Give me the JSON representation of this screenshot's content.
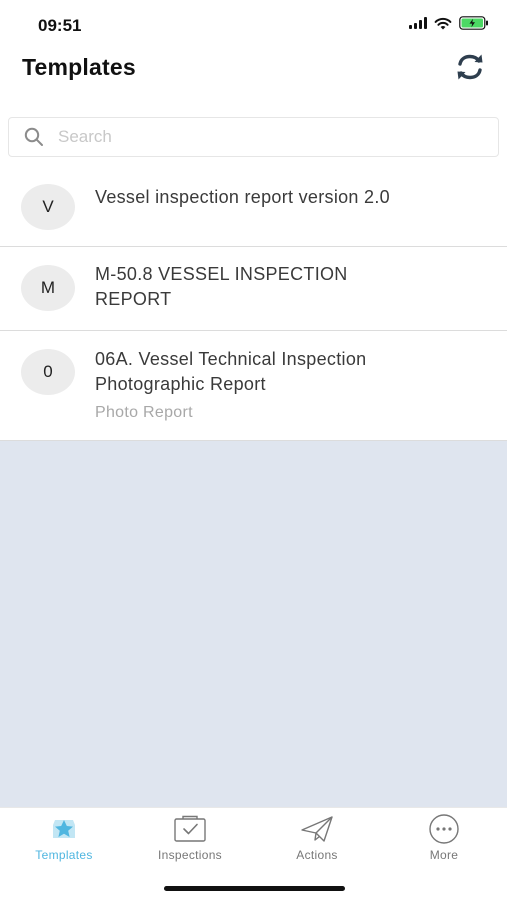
{
  "status_bar": {
    "time": "09:51"
  },
  "header": {
    "title": "Templates"
  },
  "search": {
    "placeholder": "Search"
  },
  "templates": [
    {
      "avatar": "V",
      "title": "Vessel inspection report version 2.0"
    },
    {
      "avatar": "M",
      "title": "M-50.8 VESSEL INSPECTION REPORT"
    },
    {
      "avatar": "0",
      "title": "06A. Vessel Technical Inspection Photographic Report",
      "subtitle": "Photo Report"
    }
  ],
  "tabbar": {
    "tabs": [
      {
        "label": "Templates",
        "icon": "star-badge-icon",
        "active": true
      },
      {
        "label": "Inspections",
        "icon": "clipboard-check-icon",
        "active": false
      },
      {
        "label": "Actions",
        "icon": "paper-plane-icon",
        "active": false
      },
      {
        "label": "More",
        "icon": "more-dots-icon",
        "active": false
      }
    ]
  },
  "colors": {
    "accent": "#4fb6e0",
    "empty_background": "#dfe5ef",
    "battery_green": "#4cd964"
  }
}
